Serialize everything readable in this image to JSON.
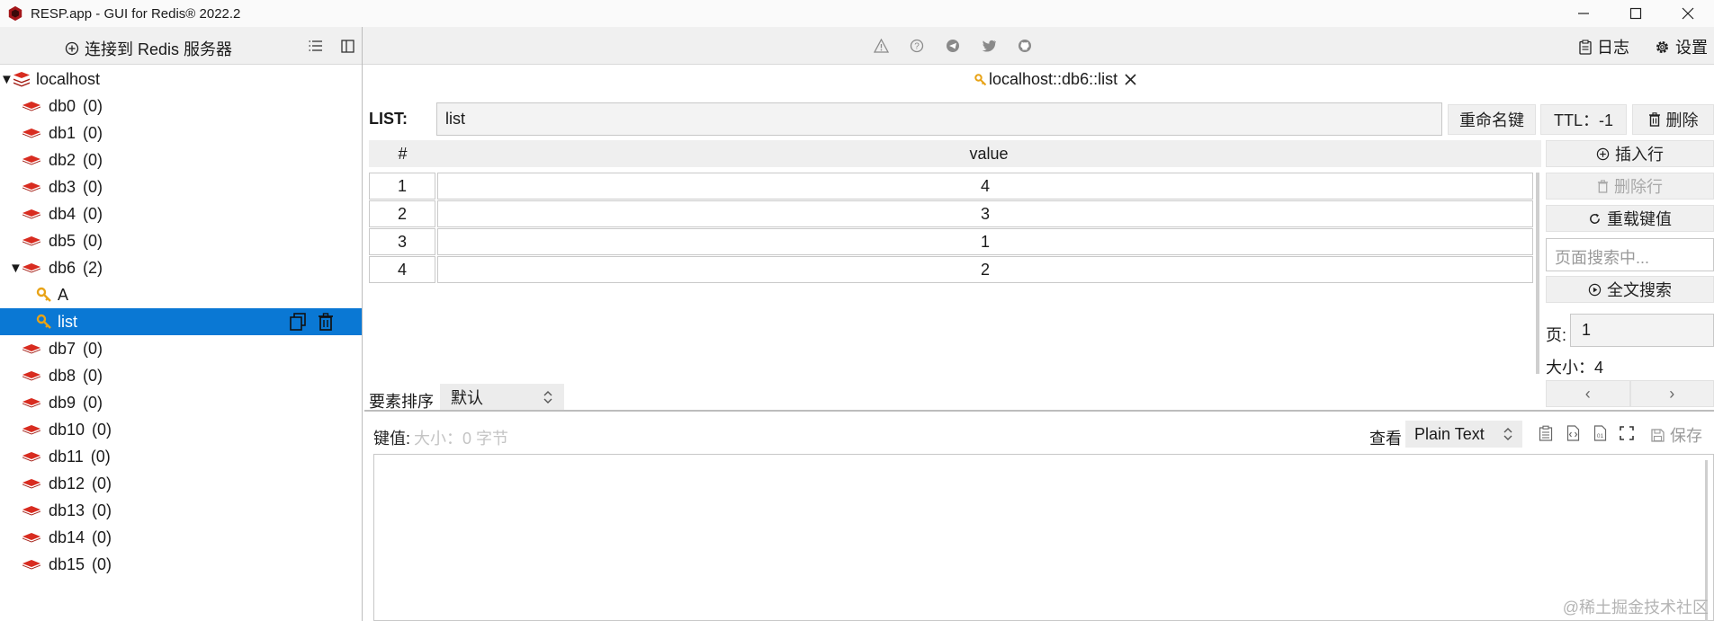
{
  "window": {
    "title": "RESP.app - GUI for Redis® 2022.2",
    "controls": [
      "minimize",
      "maximize",
      "close"
    ]
  },
  "toolbar": {
    "connect_label": "连接到 Redis 服务器",
    "log_label": "日志",
    "settings_label": "设置",
    "center_icons": [
      "warning-icon",
      "help-icon",
      "telegram-icon",
      "twitter-icon",
      "github-icon"
    ]
  },
  "tree": {
    "server": "localhost",
    "databases": [
      {
        "name": "db0",
        "count": "(0)"
      },
      {
        "name": "db1",
        "count": "(0)"
      },
      {
        "name": "db2",
        "count": "(0)"
      },
      {
        "name": "db3",
        "count": "(0)"
      },
      {
        "name": "db4",
        "count": "(0)"
      },
      {
        "name": "db5",
        "count": "(0)"
      },
      {
        "name": "db6",
        "count": "(2)"
      },
      {
        "name": "db7",
        "count": "(0)"
      },
      {
        "name": "db8",
        "count": "(0)"
      },
      {
        "name": "db9",
        "count": "(0)"
      },
      {
        "name": "db10",
        "count": "(0)"
      },
      {
        "name": "db11",
        "count": "(0)"
      },
      {
        "name": "db12",
        "count": "(0)"
      },
      {
        "name": "db13",
        "count": "(0)"
      },
      {
        "name": "db14",
        "count": "(0)"
      },
      {
        "name": "db15",
        "count": "(0)"
      }
    ],
    "db6_keys": [
      "A",
      "list"
    ],
    "selected_key": "list"
  },
  "tab": {
    "title": "localhost::db6::list"
  },
  "key": {
    "type_label": "LIST:",
    "name": "list",
    "rename_label": "重命名键",
    "ttl_label": "TTL：-1",
    "delete_label": "删除"
  },
  "table": {
    "columns": [
      "#",
      "value"
    ],
    "rows": [
      {
        "idx": "1",
        "value": "4"
      },
      {
        "idx": "2",
        "value": "3"
      },
      {
        "idx": "3",
        "value": "1"
      },
      {
        "idx": "4",
        "value": "2"
      }
    ]
  },
  "side": {
    "insert_row": "插入行",
    "delete_row": "删除行",
    "reload": "重载键值",
    "search_placeholder": "页面搜索中...",
    "fulltext_search": "全文搜索",
    "page_label": "页:",
    "page_value": "1",
    "size_label": "大小：4",
    "prev": "‹",
    "next": "›"
  },
  "sort": {
    "label": "要素排序",
    "value": "默认"
  },
  "viewer": {
    "value_label": "键值:",
    "size_text": "大小：0 字节",
    "view_label": "查看",
    "view_format": "Plain Text",
    "save_label": "保存"
  },
  "watermark": "@稀土掘金技术社区",
  "colors": {
    "selection": "#0a78d4",
    "redis_red": "#d82c20",
    "key_gold": "#e8a317"
  }
}
